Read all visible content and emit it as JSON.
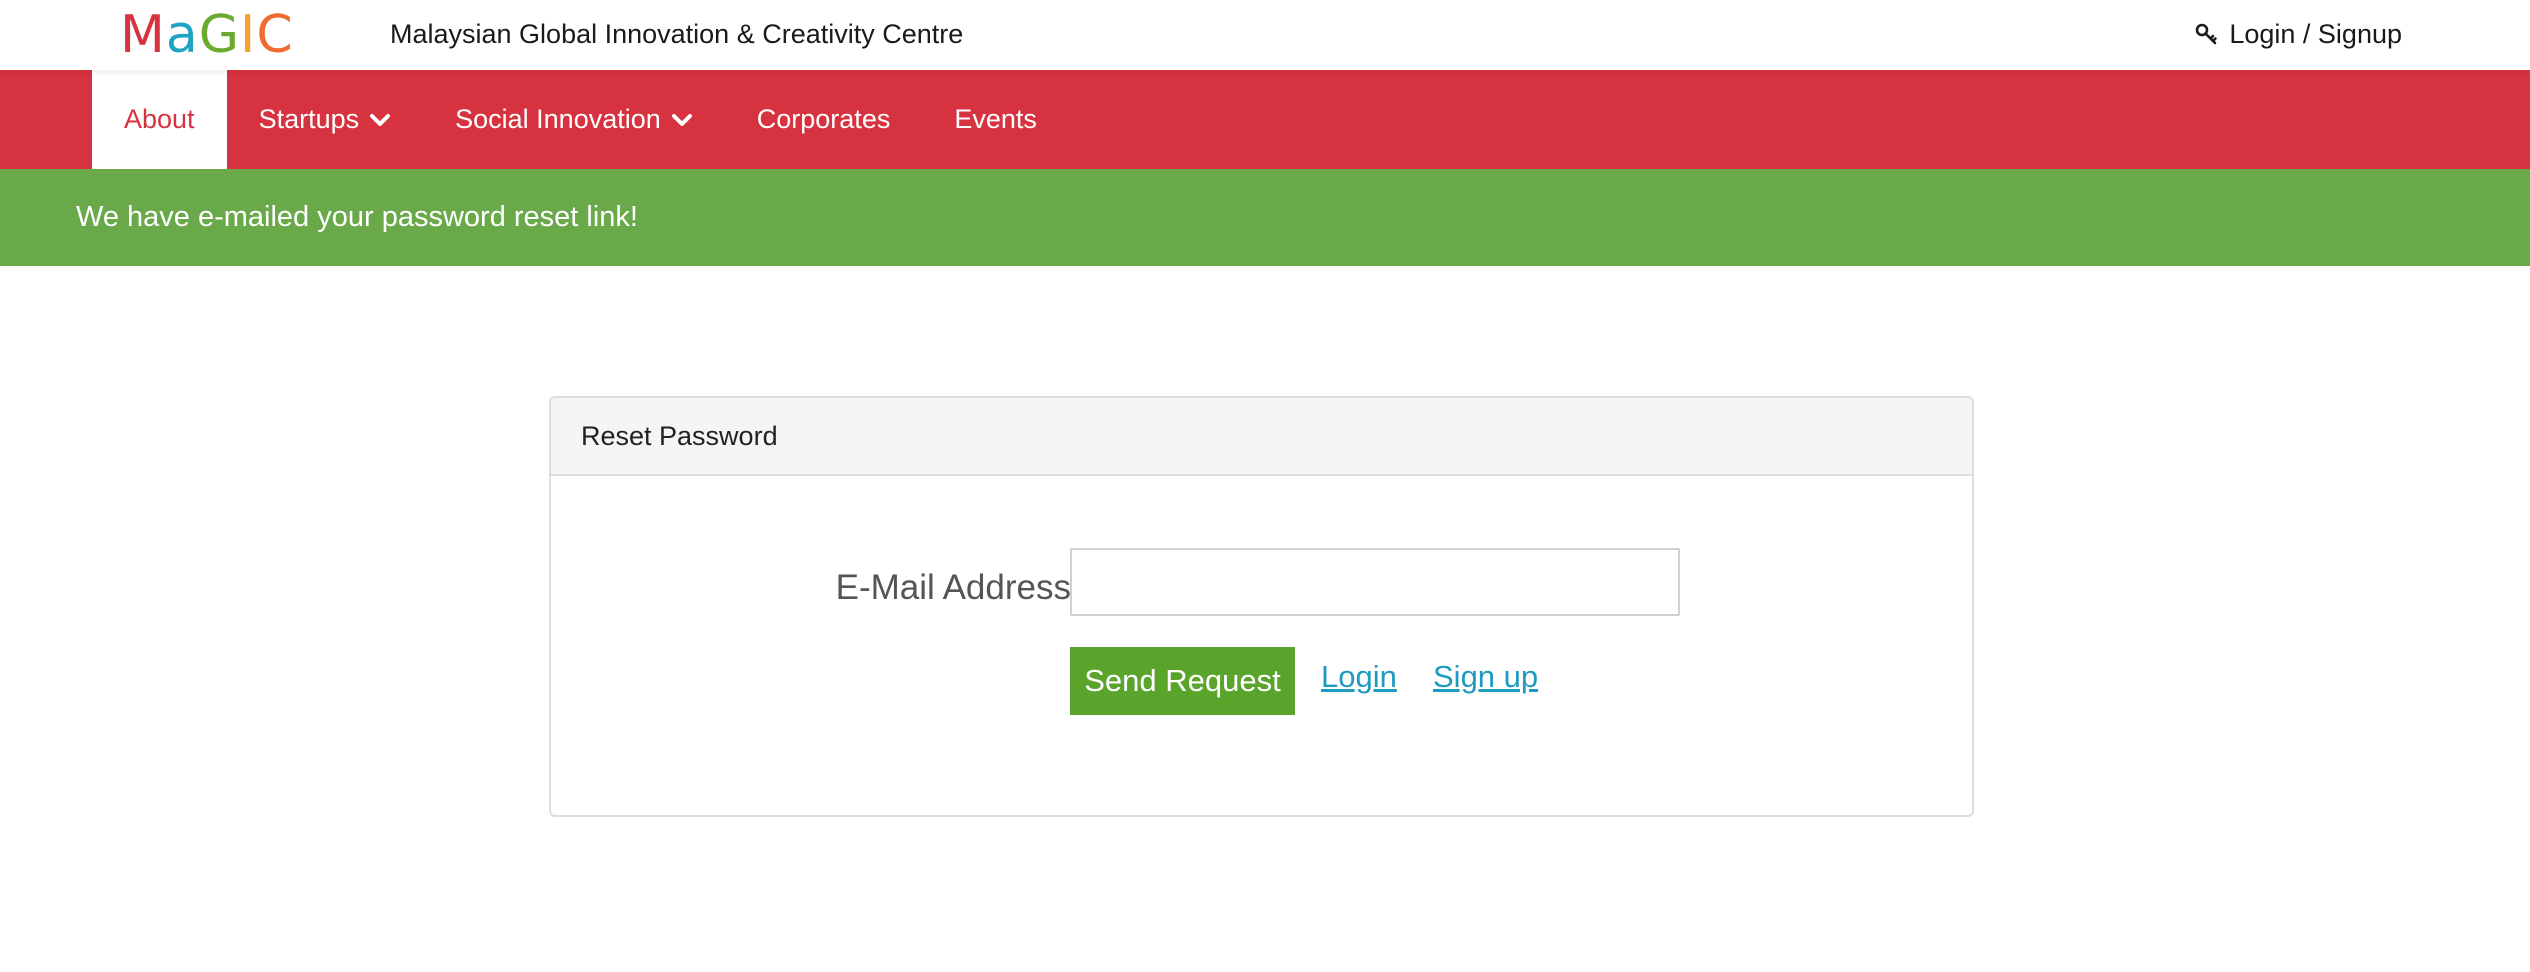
{
  "header": {
    "logo": {
      "letters": [
        {
          "char": "M",
          "color": "#d7323f"
        },
        {
          "char": "a",
          "color": "#1fa3c3"
        },
        {
          "char": "G",
          "color": "#6aaa2e"
        },
        {
          "char": "I",
          "color": "#f3a229"
        },
        {
          "char": "C",
          "color": "#ef6b2f"
        }
      ]
    },
    "site_title": "Malaysian Global Innovation & Creativity Centre",
    "auth_link": {
      "label": "Login / Signup",
      "icon": "key-icon"
    }
  },
  "nav": {
    "background_color": "#d7323f",
    "items": [
      {
        "label": "About",
        "active": true,
        "has_dropdown": false
      },
      {
        "label": "Startups",
        "active": false,
        "has_dropdown": true
      },
      {
        "label": "Social Innovation",
        "active": false,
        "has_dropdown": true
      },
      {
        "label": "Corporates",
        "active": false,
        "has_dropdown": false
      },
      {
        "label": "Events",
        "active": false,
        "has_dropdown": false
      }
    ]
  },
  "alert": {
    "message": "We have e-mailed your password reset link!",
    "background_color": "#69a94a"
  },
  "panel": {
    "title": "Reset Password",
    "email_label": "E-Mail Address",
    "email_value": "",
    "send_button_label": "Send Request",
    "send_button_color": "#5aa42b",
    "login_link": "Login",
    "signup_link": "Sign up",
    "link_color": "#1f9bc0"
  }
}
